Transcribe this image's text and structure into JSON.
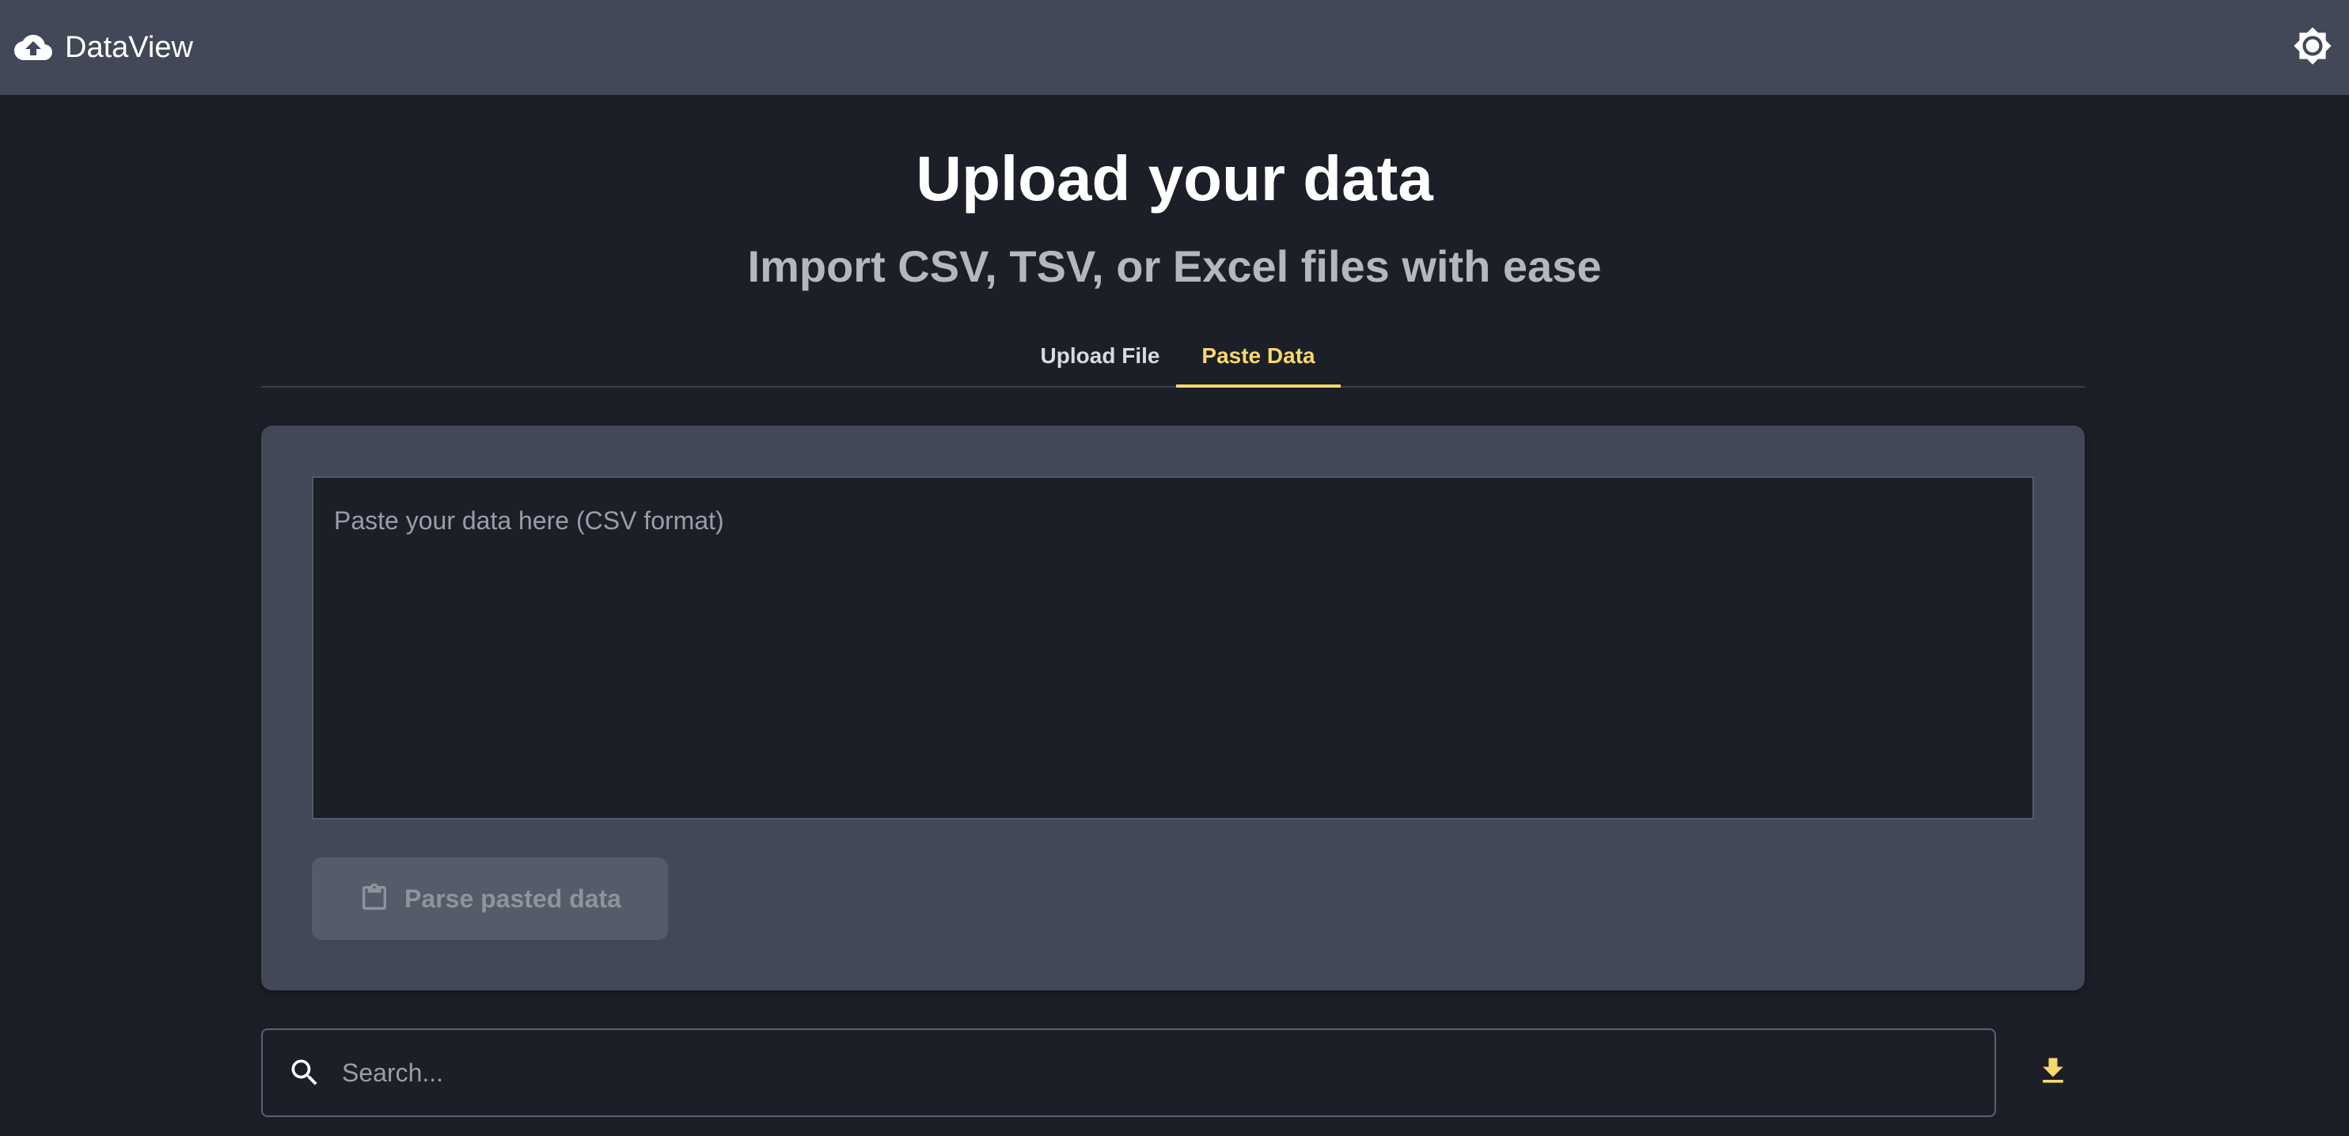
{
  "appbar": {
    "brand_name": "DataView",
    "brand_icon": "cloud-upload-icon",
    "theme_icon": "brightness-icon"
  },
  "header": {
    "title": "Upload your data",
    "subtitle": "Import CSV, TSV, or Excel files with ease"
  },
  "tabs": [
    {
      "label": "Upload File",
      "active": false
    },
    {
      "label": "Paste Data",
      "active": true
    }
  ],
  "paste": {
    "placeholder": "Paste your data here (CSV format)",
    "value": "",
    "button_label": "Parse pasted data",
    "button_icon": "clipboard-icon",
    "button_enabled": false
  },
  "search": {
    "placeholder": "Search...",
    "value": "",
    "icon": "search-icon"
  },
  "download": {
    "icon": "download-icon"
  },
  "colors": {
    "background": "#1c1f28",
    "surface": "#424858",
    "accent": "#f6d96b",
    "text_primary": "#ffffff",
    "text_secondary": "#b4b7bd"
  }
}
